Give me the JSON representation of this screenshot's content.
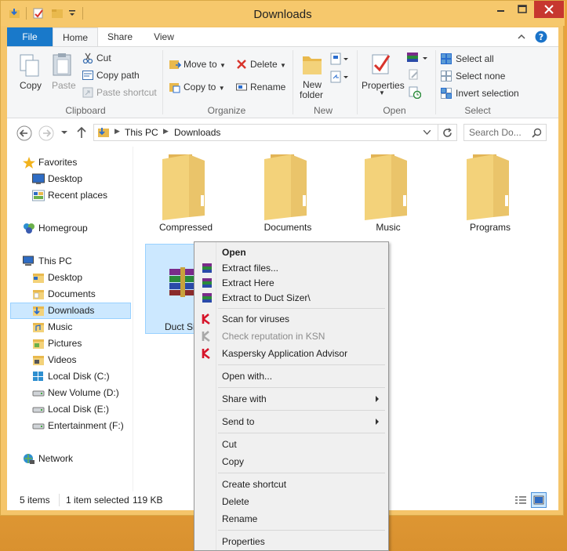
{
  "window": {
    "title": "Downloads"
  },
  "ribbon_tabs": {
    "file": "File",
    "home": "Home",
    "share": "Share",
    "view": "View"
  },
  "clipboard": {
    "copy": "Copy",
    "paste": "Paste",
    "cut": "Cut",
    "copy_path": "Copy path",
    "paste_shortcut": "Paste shortcut",
    "label": "Clipboard"
  },
  "organize": {
    "move_to": "Move to",
    "copy_to": "Copy to",
    "delete": "Delete",
    "rename": "Rename",
    "label": "Organize"
  },
  "new_group": {
    "new_folder_line1": "New",
    "new_folder_line2": "folder",
    "label": "New"
  },
  "open_group": {
    "properties": "Properties",
    "label": "Open"
  },
  "select_group": {
    "select_all": "Select all",
    "select_none": "Select none",
    "invert": "Invert selection",
    "label": "Select"
  },
  "address": {
    "crumbs": [
      "This PC",
      "Downloads"
    ],
    "search_placeholder": "Search Do..."
  },
  "nav": {
    "favorites": "Favorites",
    "desktop": "Desktop",
    "recent": "Recent places",
    "homegroup": "Homegroup",
    "this_pc": "This PC",
    "pc_items": [
      "Desktop",
      "Documents",
      "Downloads",
      "Music",
      "Pictures",
      "Videos",
      "Local Disk (C:)",
      "New Volume (D:)",
      "Local Disk (E:)",
      "Entertainment (F:)"
    ],
    "network": "Network"
  },
  "content": {
    "folders": [
      "Compressed",
      "Documents",
      "Music",
      "Programs"
    ],
    "selected_file": "Duct Si"
  },
  "status": {
    "items": "5 items",
    "selected": "1 item selected",
    "size": "119 KB"
  },
  "context_menu": {
    "open": "Open",
    "extract_files": "Extract files...",
    "extract_here": "Extract Here",
    "extract_to": "Extract to Duct Sizer\\",
    "scan": "Scan for viruses",
    "check_rep": "Check reputation in KSN",
    "kaspersky": "Kaspersky Application Advisor",
    "open_with": "Open with...",
    "share_with": "Share with",
    "send_to": "Send to",
    "cut": "Cut",
    "copy": "Copy",
    "create_shortcut": "Create shortcut",
    "delete": "Delete",
    "rename": "Rename",
    "properties": "Properties"
  },
  "colors": {
    "file_tab": "#1979ca",
    "title_bar": "#f6c86c",
    "folder": "#f3d27a",
    "selection": "#cce8ff",
    "kaspersky": "#d6142a"
  }
}
